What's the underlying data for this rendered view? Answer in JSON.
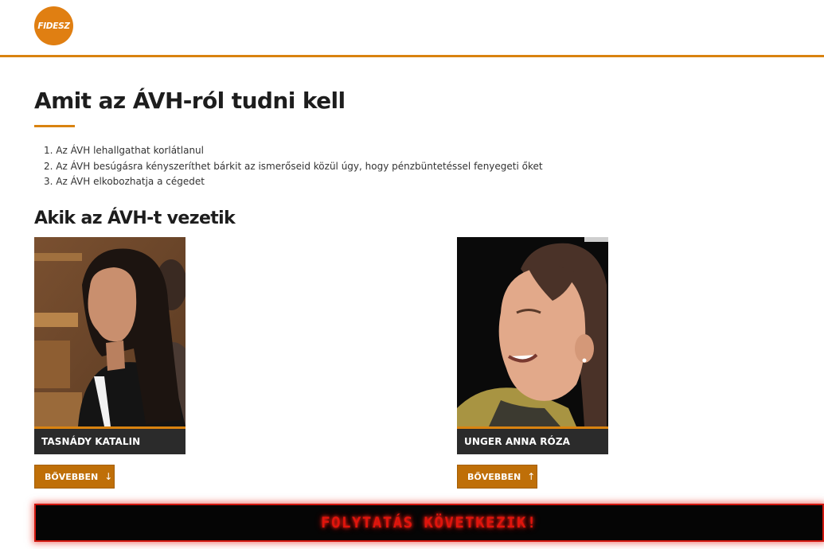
{
  "header": {
    "logo_text": "FIDESZ",
    "accent_color": "#d98310"
  },
  "main": {
    "title": "Amit az ÁVH-ról tudni kell",
    "facts": [
      "1. Az ÁVH lehallgathat korlátlanul",
      "2. Az ÁVH besúgásra kényszeríthet bárkit az ismerőseid közül úgy, hogy pénzbüntetéssel fenyegeti őket",
      "3. Az ÁVH elkobozhatja a cégedet"
    ],
    "subtitle": "Akik az ÁVH-t vezetik"
  },
  "people": [
    {
      "name": "TASNÁDY KATALIN",
      "button_label": "BŐVEBBEN",
      "button_icon": "↓"
    },
    {
      "name": "UNGER ANNA RÓZA",
      "button_label": "BŐVEBBEN",
      "button_icon": "↑"
    }
  ],
  "banner": {
    "text": "FOLYTATÁS KÖVETKEZIK!",
    "color": "#e0140c"
  }
}
